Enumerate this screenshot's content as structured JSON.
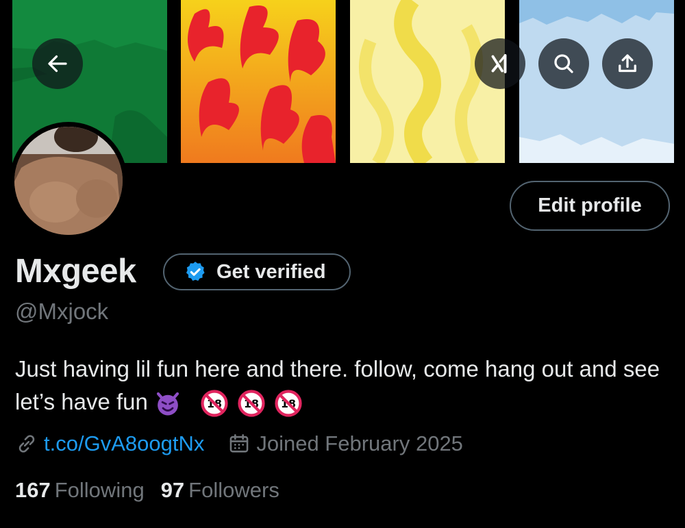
{
  "profile": {
    "display_name": "Mxgeek",
    "handle": "@Mxjock",
    "bio_text": "Just having lil fun here and there. follow, come hang out and see let’s have fun",
    "bio_emojis": [
      "smiling-imp-emoji",
      "no-one-under-18-emoji",
      "no-one-under-18-emoji",
      "no-one-under-18-emoji"
    ],
    "link": "t.co/GvA8oogtNx",
    "joined": "Joined February 2025"
  },
  "actions": {
    "edit_profile_label": "Edit profile",
    "get_verified_label": "Get verified"
  },
  "stats": {
    "following_count": "167",
    "following_label": "Following",
    "followers_count": "97",
    "followers_label": "Followers"
  },
  "banner": {
    "icons": [
      "back-arrow-icon",
      "grok-icon",
      "search-icon",
      "share-icon"
    ]
  },
  "colors": {
    "background": "#000000",
    "text_primary": "#e7e9ea",
    "text_secondary": "#71767b",
    "link": "#1d9bf0",
    "verified_badge": "#1d9bf0",
    "border": "#536471"
  }
}
